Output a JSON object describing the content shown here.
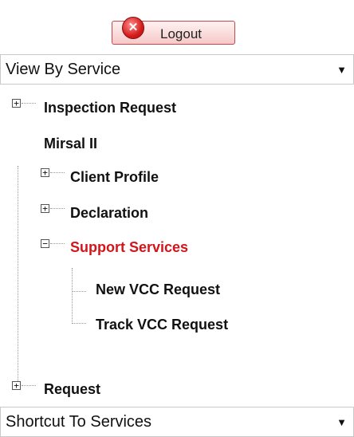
{
  "header": {
    "logout_label": "Logout",
    "logout_icon": "close-icon"
  },
  "view_select": {
    "selected": "View By Service",
    "arrow": "▼"
  },
  "tree": {
    "inspection_request": "Inspection Request",
    "mirsal": "Mirsal II",
    "client_profile": "Client Profile",
    "declaration": "Declaration",
    "support_services": "Support Services",
    "new_vcc": "New VCC Request",
    "track_vcc": "Track VCC Request",
    "request": "Request",
    "expander_plus": "+",
    "expander_minus": "−"
  },
  "shortcut_select": {
    "selected": "Shortcut To Services",
    "arrow": "▼"
  },
  "colors": {
    "active_node": "#d4141b",
    "logout_border": "#c24a4a"
  }
}
